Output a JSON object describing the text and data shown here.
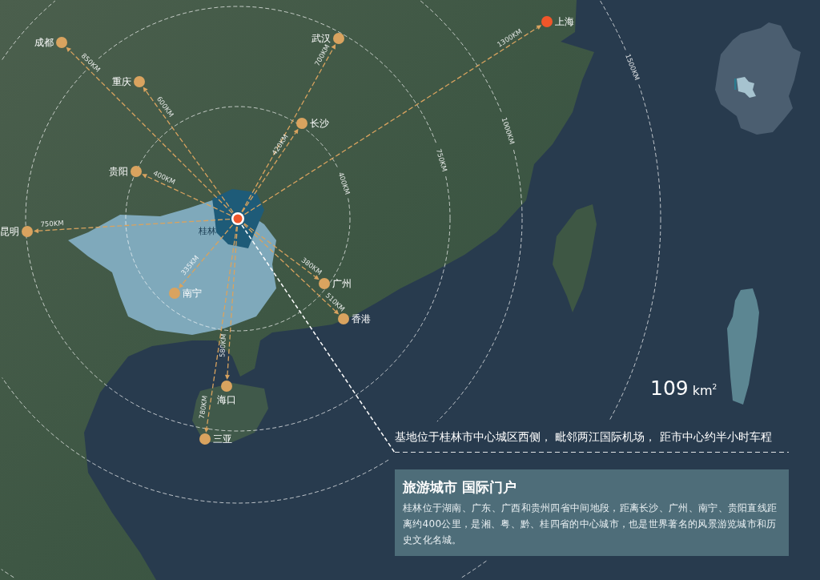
{
  "map": {
    "center": {
      "label": "桂林"
    },
    "cities": [
      {
        "name": "成都",
        "distance": "850KM",
        "color": "#d9a35f"
      },
      {
        "name": "重庆",
        "distance": "600KM",
        "color": "#d9a35f"
      },
      {
        "name": "武汉",
        "distance": "700KM",
        "color": "#d9a35f"
      },
      {
        "name": "长沙",
        "distance": "420KM",
        "color": "#d9a35f"
      },
      {
        "name": "贵阳",
        "distance": "400KM",
        "color": "#d9a35f"
      },
      {
        "name": "昆明",
        "distance": "750KM",
        "color": "#d9a35f"
      },
      {
        "name": "南宁",
        "distance": "335KM",
        "color": "#d9a35f"
      },
      {
        "name": "广州",
        "distance": "380KM",
        "color": "#d9a35f"
      },
      {
        "name": "香港",
        "distance": "510KM",
        "color": "#d9a35f"
      },
      {
        "name": "海口",
        "distance": "580KM",
        "color": "#d9a35f"
      },
      {
        "name": "三亚",
        "distance": "780KM",
        "color": "#d9a35f"
      },
      {
        "name": "上海",
        "distance": "1300KM",
        "color": "#f0562a"
      }
    ],
    "rings": [
      {
        "label": "400KM"
      },
      {
        "label": "750KM"
      },
      {
        "label": "1000KM"
      },
      {
        "label": "1500KM"
      }
    ]
  },
  "area": {
    "value": "109",
    "unit": "km$^{2}$"
  },
  "caption": "基地位于桂林市中心城区西侧， 毗邻两江国际机场， 距市中心约半小时车程",
  "info_panel": {
    "title": "旅游城市 国际门户",
    "body": "桂林位于湖南、广东、广西和贵州四省中间地段，距离长沙、广州、南宁、贵阳直线距离约400公里，是湘、粤、黔、桂四省的中心城市，也是世界著名的风景游览城市和历史文化名城。"
  }
}
